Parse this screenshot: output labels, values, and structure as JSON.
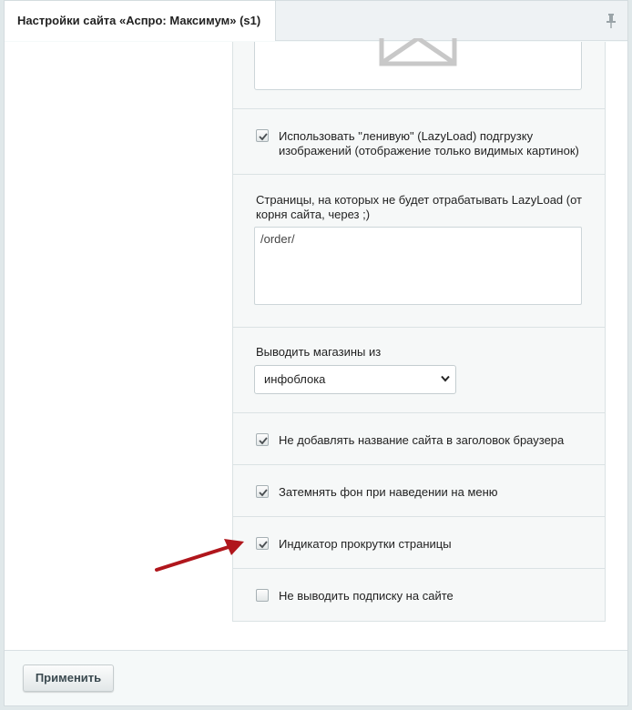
{
  "tab": {
    "title": "Настройки сайта «Аспро: Максимум» (s1)"
  },
  "settings": {
    "lazyload": {
      "label_line1": "Использовать \"ленивую\" (LazyLoad) подгрузку",
      "label_line2": "изображений (отображение только видимых картинок)",
      "checked": true
    },
    "lazyload_exclude": {
      "label_line1": "Страницы, на которых не будет отрабатывать LazyLoad (от",
      "label_line2": "корня сайта, через ;)",
      "value": "/order/"
    },
    "stores_source": {
      "label": "Выводить магазины из",
      "selected": "инфоблока"
    },
    "no_site_name_in_title": {
      "label": "Не добавлять название сайта в заголовок браузера",
      "checked": true
    },
    "dim_on_menu_hover": {
      "label": "Затемнять фон при наведении на меню",
      "checked": true
    },
    "scroll_indicator": {
      "label": "Индикатор прокрутки страницы",
      "checked": true
    },
    "no_subscription": {
      "label": "Не выводить подписку на сайте",
      "checked": false
    }
  },
  "footer": {
    "apply_label": "Применить"
  },
  "annotation": {
    "arrow_color": "#b0161c"
  }
}
